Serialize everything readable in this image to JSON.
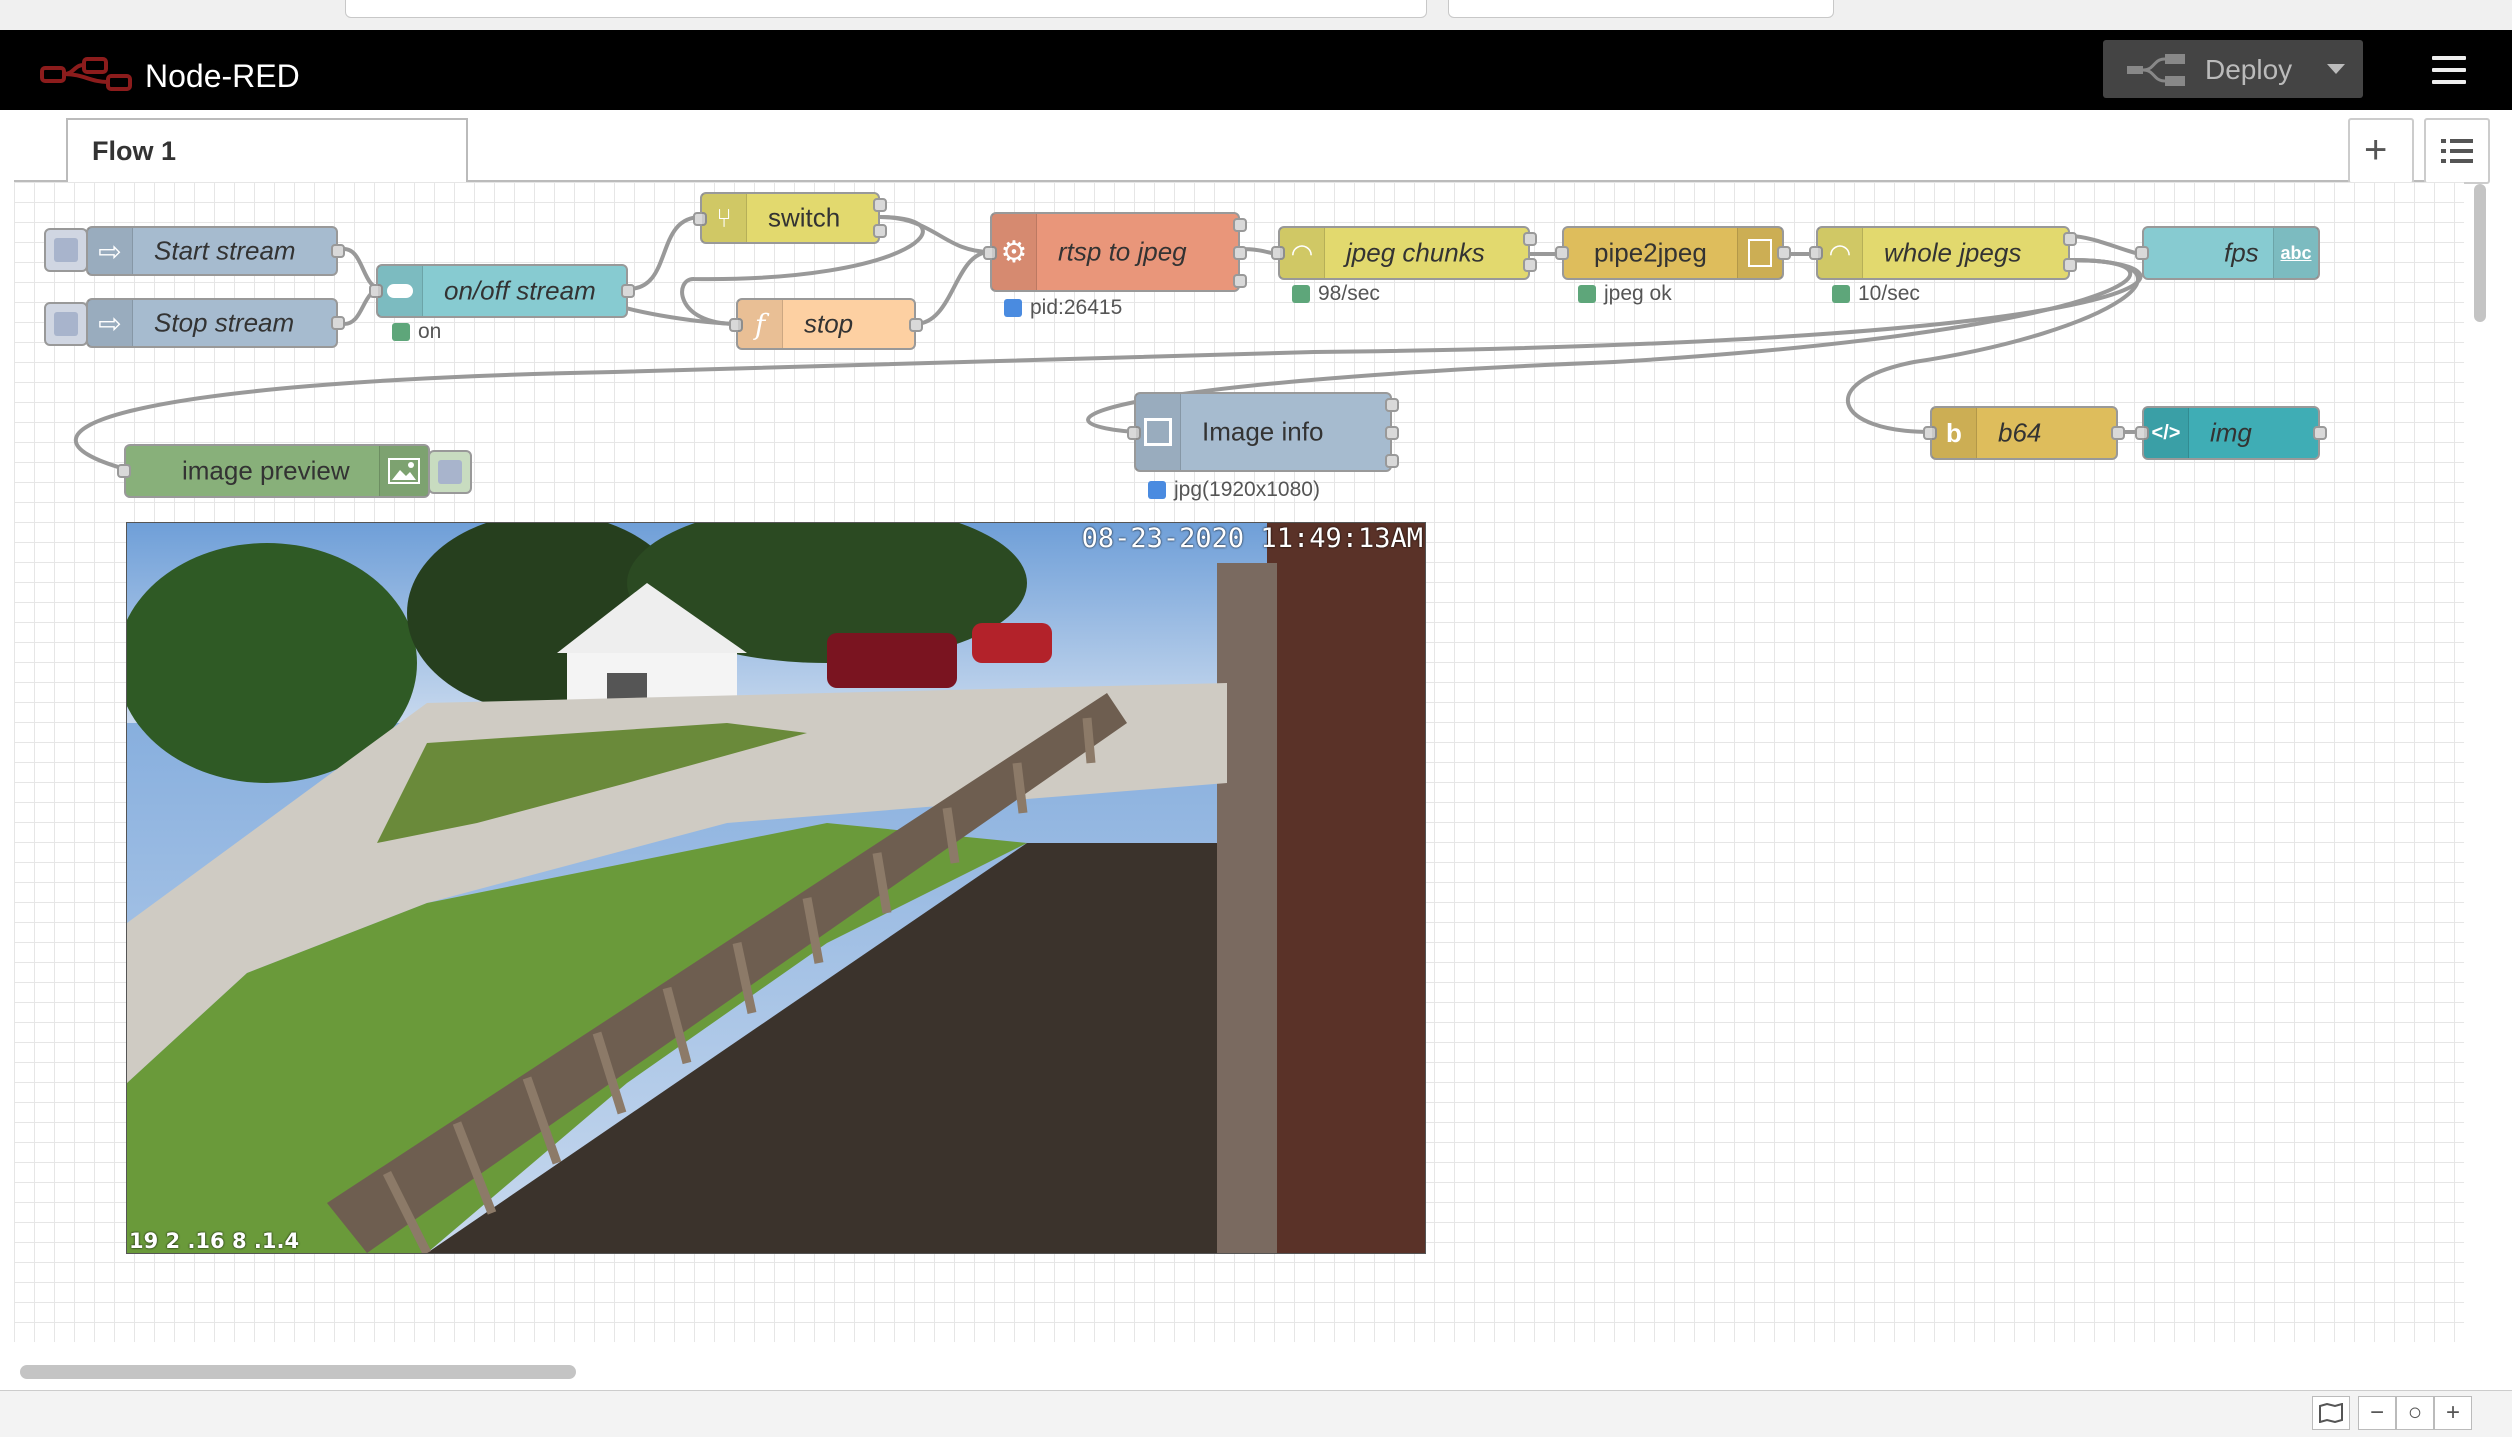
{
  "app": {
    "title": "Node-RED",
    "deploy_label": "Deploy"
  },
  "tabs": [
    {
      "label": "Flow 1"
    }
  ],
  "tab_actions": {
    "add": "+",
    "list": "list-icon"
  },
  "nodes": {
    "start_stream": {
      "label": "Start stream"
    },
    "stop_stream": {
      "label": "Stop stream"
    },
    "onoff_stream": {
      "label": "on/off stream",
      "status": "on"
    },
    "switch": {
      "label": "switch"
    },
    "stop": {
      "label": "stop"
    },
    "rtsp_to_jpeg": {
      "label": "rtsp to jpeg",
      "status": "pid:26415"
    },
    "jpeg_chunks": {
      "label": "jpeg chunks",
      "status": "98/sec"
    },
    "pipe2jpeg": {
      "label": "pipe2jpeg",
      "status": "jpeg ok"
    },
    "whole_jpegs": {
      "label": "whole jpegs",
      "status": "10/sec"
    },
    "fps": {
      "label": "fps"
    },
    "image_info": {
      "label": "Image info",
      "status": "jpg(1920x1080)"
    },
    "b64": {
      "label": "b64"
    },
    "img": {
      "label": "img"
    },
    "image_preview": {
      "label": "image preview"
    }
  },
  "preview": {
    "timestamp": "08-23-2020 11:49:13AM",
    "ip_overlay": "19 2 .16 8 .1.4"
  },
  "colors": {
    "inject": "#a6bbcf",
    "switch_node": "#e2d96e",
    "function_node": "#fdd0a2",
    "exec_node": "#e9967a",
    "toggle_node": "#87cbd1",
    "base64": "#debd5c",
    "template": "#3fadb5",
    "preview": "#88b07a",
    "status_green": "#5ea67a",
    "status_blue": "#4a8be0",
    "header_bg": "#000000"
  },
  "footer": {
    "zoom_out": "−",
    "zoom_reset": "○",
    "zoom_in": "+"
  }
}
